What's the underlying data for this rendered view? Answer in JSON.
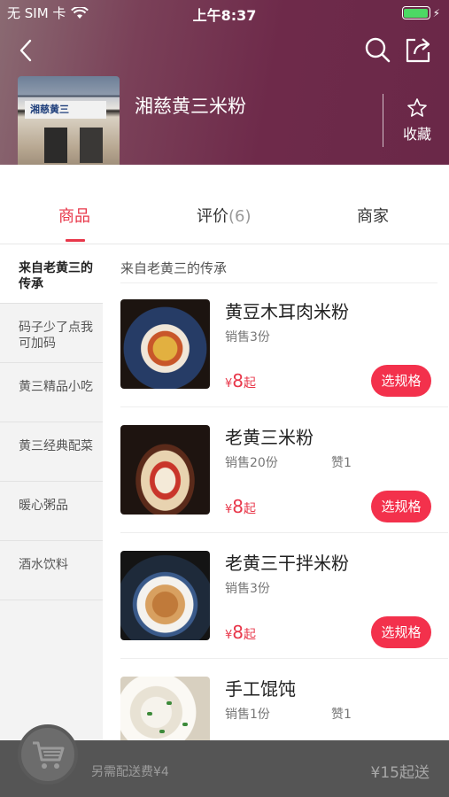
{
  "status_bar": {
    "carrier": "无 SIM 卡",
    "time": "上午8:37"
  },
  "store": {
    "name": "湘慈黄三米粉",
    "sign_text": "湘慈黄三",
    "favorite_label": "收藏"
  },
  "tabs": [
    {
      "label": "商品",
      "active": true
    },
    {
      "label": "评价",
      "count": "(6)"
    },
    {
      "label": "商家"
    }
  ],
  "categories": [
    {
      "label": "来自老黄三的传承",
      "active": true
    },
    {
      "label": "码子少了点我可加码"
    },
    {
      "label": "黄三精品小吃"
    },
    {
      "label": "黄三经典配菜"
    },
    {
      "label": "暖心粥品"
    },
    {
      "label": "酒水饮料"
    }
  ],
  "section_title": "来自老黄三的传承",
  "products": [
    {
      "name": "黄豆木耳肉米粉",
      "sales": "销售3份",
      "likes": "",
      "price_symbol": "¥",
      "price": "8",
      "price_suffix": "起",
      "button": "选规格"
    },
    {
      "name": "老黄三米粉",
      "sales": "销售20份",
      "likes": "赞1",
      "price_symbol": "¥",
      "price": "8",
      "price_suffix": "起",
      "button": "选规格"
    },
    {
      "name": "老黄三干拌米粉",
      "sales": "销售3份",
      "likes": "",
      "price_symbol": "¥",
      "price": "8",
      "price_suffix": "起",
      "button": "选规格"
    },
    {
      "name": "手工馄饨",
      "sales": "销售1份",
      "likes": "赞1",
      "price_symbol": "",
      "price": "",
      "price_suffix": "",
      "button": ""
    }
  ],
  "cart": {
    "delivery_fee": "另需配送费¥4",
    "min_order": "¥15起送"
  },
  "colors": {
    "accent": "#e8374a",
    "button": "#f3314c",
    "cart_bar": "#555555"
  }
}
